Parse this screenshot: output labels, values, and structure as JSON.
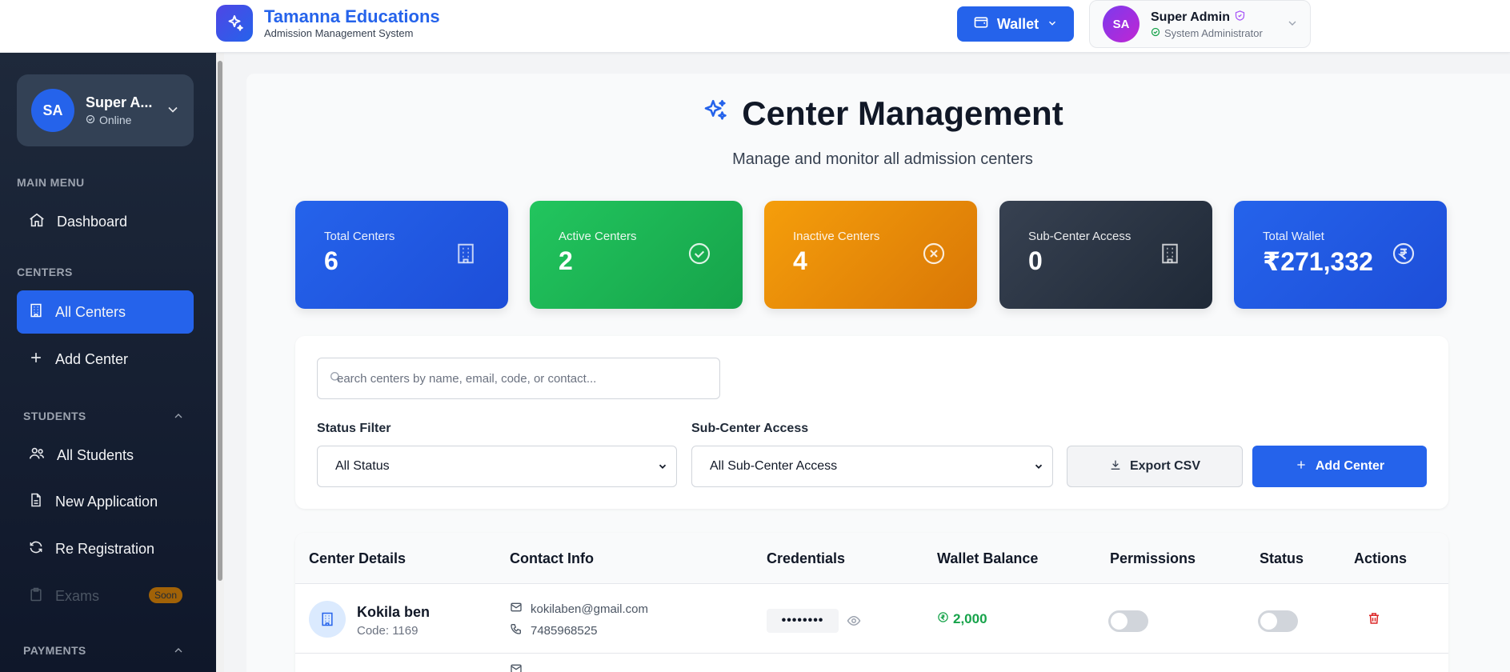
{
  "header": {
    "brand_title": "Tamanna Educations",
    "brand_subtitle": "Admission Management System",
    "wallet_label": "Wallet",
    "user_initials": "SA",
    "user_name": "Super Admin",
    "user_role": "System Administrator"
  },
  "sidebar": {
    "profile": {
      "initials": "SA",
      "name": "Super A...",
      "status": "Online"
    },
    "sections": {
      "main_menu": "MAIN MENU",
      "centers": "CENTERS",
      "students": "STUDENTS",
      "payments": "PAYMENTS"
    },
    "items": {
      "dashboard": "Dashboard",
      "all_centers": "All Centers",
      "add_center": "Add Center",
      "all_students": "All Students",
      "new_application": "New Application",
      "re_registration": "Re Registration",
      "exams": "Exams",
      "exams_badge": "Soon"
    }
  },
  "page": {
    "title": "Center Management",
    "subtitle": "Manage and monitor all admission centers"
  },
  "stats": [
    {
      "label": "Total Centers",
      "value": "6",
      "color": "#2563eb",
      "icon": "building-icon"
    },
    {
      "label": "Active Centers",
      "value": "2",
      "color": "#16a34a",
      "icon": "check-circle-icon"
    },
    {
      "label": "Inactive Centers",
      "value": "4",
      "color": "#ea8a0c",
      "icon": "x-circle-icon"
    },
    {
      "label": "Sub-Center Access",
      "value": "0",
      "color": "#1f2937",
      "icon": "building-icon"
    },
    {
      "label": "Total Wallet",
      "value": "₹271,332",
      "color": "#2563eb",
      "icon": "rupee-icon"
    }
  ],
  "filters": {
    "search_placeholder": "earch centers by name, email, code, or contact...",
    "status_label": "Status Filter",
    "status_value": "All Status",
    "subcenter_label": "Sub-Center Access",
    "subcenter_value": "All Sub-Center Access",
    "export_label": "Export CSV",
    "add_label": "Add Center"
  },
  "table": {
    "headers": [
      "Center Details",
      "Contact Info",
      "Credentials",
      "Wallet Balance",
      "Permissions",
      "Status",
      "Actions"
    ],
    "rows": [
      {
        "name": "Kokila ben",
        "code": "Code: 1169",
        "email": "kokilaben@gmail.com",
        "phone": "7485968525",
        "password": "••••••••",
        "wallet": "2,000"
      }
    ]
  },
  "colors": {
    "accent": "#2563eb",
    "success": "#16a34a",
    "warning": "#ea8a0c",
    "danger": "#dc2626"
  }
}
